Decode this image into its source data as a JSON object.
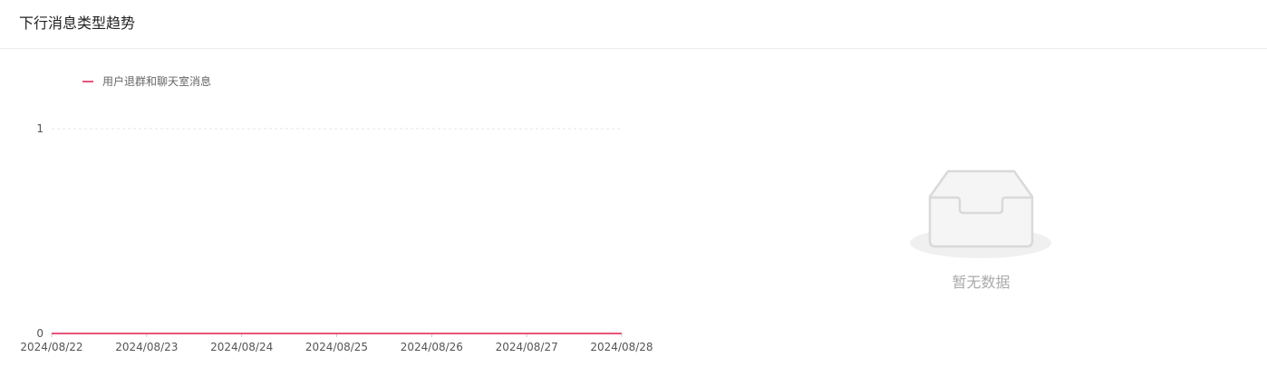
{
  "card": {
    "title": "下行消息类型趋势"
  },
  "empty": {
    "text": "暂无数据"
  },
  "colors": {
    "series": "#e9547b",
    "axis_text": "#555555",
    "legend_text": "#666666",
    "grid": "#e6e6e6",
    "empty_icon_stroke": "#d9d9d9",
    "empty_icon_fill": "#f5f5f5"
  },
  "icons": {
    "empty": "inbox-empty-icon"
  },
  "chart_data": {
    "type": "line",
    "categories": [
      "2024/08/22",
      "2024/08/23",
      "2024/08/24",
      "2024/08/25",
      "2024/08/26",
      "2024/08/27",
      "2024/08/28"
    ],
    "series": [
      {
        "name": "用户退群和聊天室消息",
        "values": [
          0,
          0,
          0,
          0,
          0,
          0,
          0
        ]
      }
    ],
    "y_ticks": [
      "0",
      "1"
    ],
    "ylim": [
      0,
      1
    ],
    "legend_position": "top-left",
    "grid": "horizontal-dashed"
  }
}
